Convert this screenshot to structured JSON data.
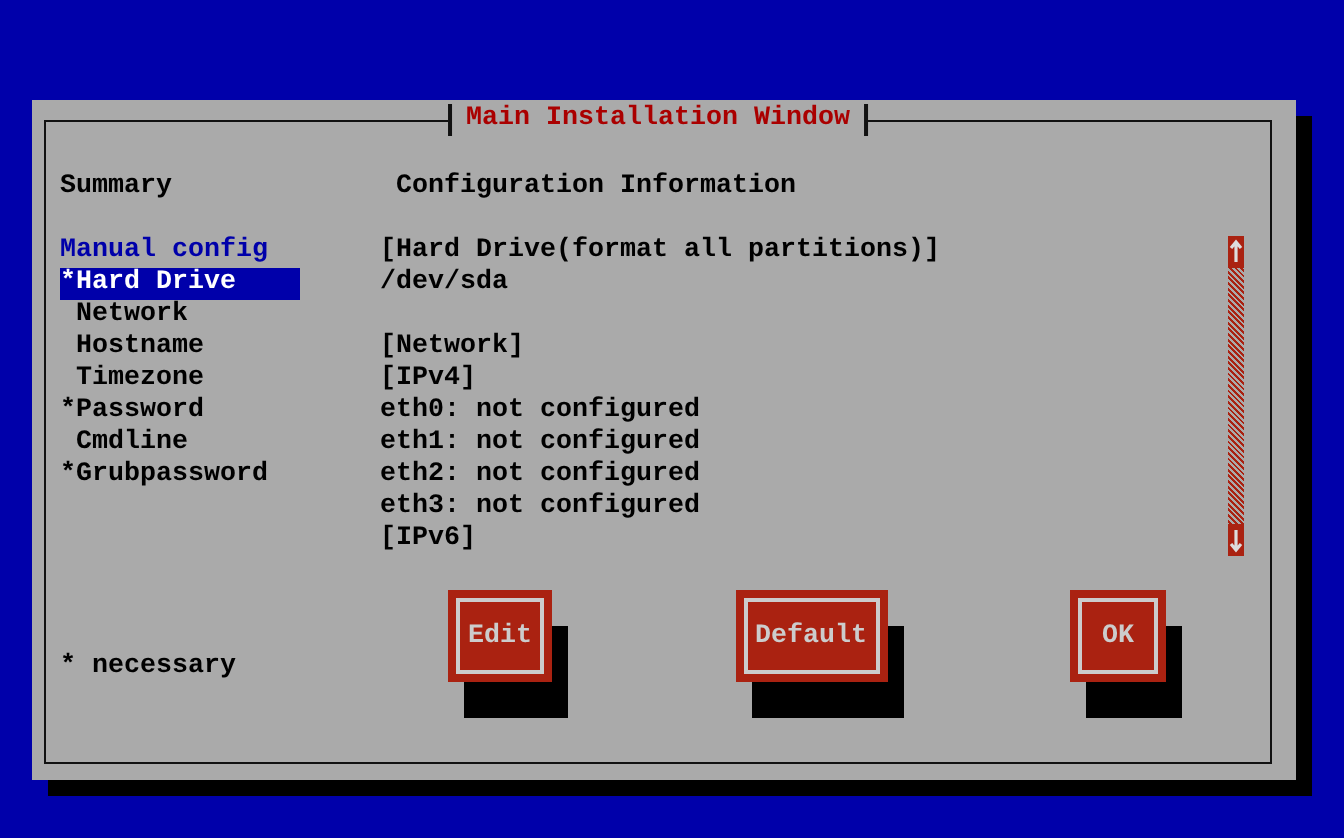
{
  "window": {
    "title": "Main Installation Window"
  },
  "summary": {
    "heading": "Summary",
    "group_label": "Manual config",
    "items": [
      {
        "label": "*Hard Drive",
        "selected": true
      },
      {
        "label": " Network",
        "selected": false
      },
      {
        "label": " Hostname",
        "selected": false
      },
      {
        "label": " Timezone",
        "selected": false
      },
      {
        "label": "*Password",
        "selected": false
      },
      {
        "label": " Cmdline",
        "selected": false
      },
      {
        "label": "*Grubpassword",
        "selected": false
      }
    ]
  },
  "configuration": {
    "heading": "Configuration Information",
    "sections": [
      {
        "lines": [
          "[Hard Drive(format all partitions)]",
          "/dev/sda"
        ]
      },
      {
        "lines": [
          "[Network]",
          "[IPv4]",
          "eth0: not configured",
          "eth1: not configured",
          "eth2: not configured",
          "eth3: not configured",
          "[IPv6]"
        ]
      }
    ]
  },
  "note": "* necessary",
  "buttons": [
    "Edit",
    "Default",
    "OK"
  ]
}
